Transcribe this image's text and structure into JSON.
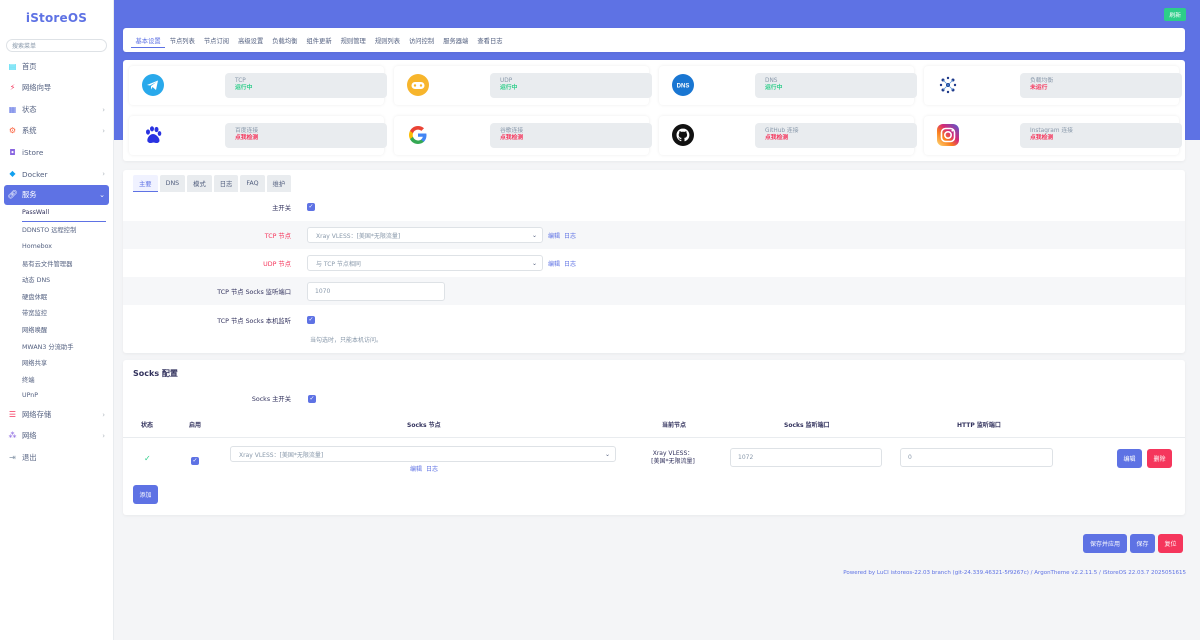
{
  "brand": "iStoreOS",
  "sidebar": {
    "search_placeholder": "搜索菜单",
    "items": [
      {
        "label": "首页",
        "icon": "home-icon"
      },
      {
        "label": "网络向导",
        "icon": "wizard-icon"
      },
      {
        "label": "状态",
        "icon": "status-icon"
      },
      {
        "label": "系统",
        "icon": "system-icon"
      },
      {
        "label": "iStore",
        "icon": "store-icon"
      },
      {
        "label": "Docker",
        "icon": "docker-icon"
      },
      {
        "label": "服务",
        "icon": "link-icon"
      }
    ],
    "services_sub": [
      "PassWall",
      "DDNSTO 远程控制",
      "Homebox",
      "易有云文件管理器",
      "动态 DNS",
      "硬盘休眠",
      "带宽监控",
      "网络唤醒",
      "MWAN3 分流助手",
      "网络共享",
      "终端",
      "UPnP"
    ],
    "bottom_items": [
      {
        "label": "网络存储",
        "icon": "storage-icon"
      },
      {
        "label": "网络",
        "icon": "network-icon"
      },
      {
        "label": "退出",
        "icon": "logout-icon"
      }
    ]
  },
  "header": {
    "refresh_label": "刷新"
  },
  "tabs": [
    "基本设置",
    "节点列表",
    "节点订阅",
    "高级设置",
    "负载均衡",
    "组件更新",
    "规则管理",
    "规则列表",
    "访问控制",
    "服务器端",
    "查看日志"
  ],
  "status_cards": [
    {
      "name": "TCP",
      "status": "运行中",
      "state": "ok",
      "icon": "telegram-icon"
    },
    {
      "name": "UDP",
      "status": "运行中",
      "state": "ok",
      "icon": "gamepad-icon"
    },
    {
      "name": "DNS",
      "status": "运行中",
      "state": "ok",
      "icon": "dns-icon"
    },
    {
      "name": "负载均衡",
      "status": "未运行",
      "state": "bad",
      "icon": "balance-icon"
    },
    {
      "name": "百度连接",
      "status": "点我检测",
      "state": "bad",
      "icon": "baidu-icon"
    },
    {
      "name": "谷歌连接",
      "status": "点我检测",
      "state": "bad",
      "icon": "google-icon"
    },
    {
      "name": "GitHub 连接",
      "status": "点我检测",
      "state": "bad",
      "icon": "github-icon"
    },
    {
      "name": "Instagram 连接",
      "status": "点我检测",
      "state": "bad",
      "icon": "instagram-icon"
    }
  ],
  "subtabs": [
    "主要",
    "DNS",
    "模式",
    "日志",
    "FAQ",
    "维护"
  ],
  "form": {
    "main_switch_label": "主开关",
    "tcp_node_label": "TCP 节点",
    "tcp_node_value": "Xray VLESS：[美国*无限流量]",
    "udp_node_label": "UDP 节点",
    "udp_node_value": "与 TCP 节点相同",
    "edit_label": "编辑",
    "log_label": "日志",
    "socks_port_label": "TCP 节点 Socks 监听端口",
    "socks_port_value": "1070",
    "socks_local_label": "TCP 节点 Socks 本机监听",
    "socks_local_hint": "当勾选时，只能本机访问。"
  },
  "socks": {
    "title": "Socks 配置",
    "main_switch_label": "Socks 主开关",
    "headers": {
      "status": "状态",
      "enable": "启用",
      "node": "Socks 节点",
      "current": "当前节点",
      "socks_port": "Socks 监听端口",
      "http_port": "HTTP 监听端口"
    },
    "row": {
      "status": "✓",
      "node_value": "Xray VLESS：[美国*无限流量]",
      "current_line1": "Xray VLESS：",
      "current_line2": "[美国*无限流量]",
      "socks_port": "1072",
      "http_port": "0",
      "edit_label": "编辑",
      "delete_label": "删除"
    },
    "add_label": "添加"
  },
  "actions": {
    "save_apply": "保存并应用",
    "save": "保存",
    "reset": "复位"
  },
  "footer": "Powered by LuCI istoreos-22.03 branch (git-24.339.46321-5f9267c) / ArgonTheme v2.2.11.5 / iStoreOS 22.03.7 2025051615",
  "colors": {
    "accent": "#5e72e4",
    "success": "#2dce89",
    "danger": "#f5365c"
  }
}
